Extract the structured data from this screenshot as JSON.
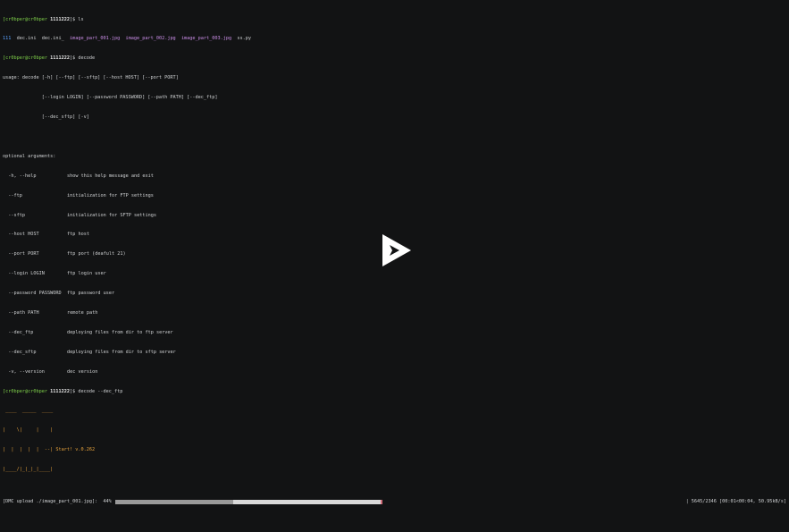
{
  "terminal": {
    "l1_user": "[cr0bper@cr0bper",
    "l1_host": "1111222",
    "l1_rest": "]$ ls",
    "ls_dir": "111",
    "ls_f1": "dec.ini",
    "ls_f2": "dec.ini_",
    "ls_img1": "image_part_001.jpg",
    "ls_img2": "image_part_002.jpg",
    "ls_img3": "image_part_003.jpg",
    "ls_py": "ss.py",
    "l3_user": "[cr0bper@cr0bper",
    "l3_host": "1111222",
    "l3_rest": "]$ decode",
    "usage1": "usage: decode [-h] [--ftp] [--sftp] [--host HOST] [--port PORT]",
    "usage2": "              [--login LOGIN] [--password PASSWORD] [--path PATH] [--dec_ftp]",
    "usage3": "              [--dec_sftp] [-v]",
    "optional_header": "optional arguments:",
    "options": [
      {
        "flag": "  -h, --help",
        "desc": "show this help message and exit"
      },
      {
        "flag": "  --ftp",
        "desc": "initialization for FTP settings"
      },
      {
        "flag": "  --sftp",
        "desc": "initialization for SFTP settings"
      },
      {
        "flag": "  --host HOST",
        "desc": "ftp host"
      },
      {
        "flag": "  --port PORT",
        "desc": "ftp port (deafult 21)"
      },
      {
        "flag": "  --login LOGIN",
        "desc": "ftp login user"
      },
      {
        "flag": "  --password PASSWORD",
        "desc": "ftp password user"
      },
      {
        "flag": "  --path PATH",
        "desc": "remote path"
      },
      {
        "flag": "  --dec_ftp",
        "desc": "deploying files from dir to ftp server"
      },
      {
        "flag": "  --dec_sftp",
        "desc": "deploying files from dir to sftp server"
      },
      {
        "flag": "  -v, --version",
        "desc": "dec version"
      }
    ],
    "l_cmd_user": "[cr0bper@cr0bper",
    "l_cmd_host": "1111222",
    "l_cmd_rest": "]$ decode --dec_ftp",
    "art1": " ____  _____  ____",
    "art2": "|    \\|     |    |",
    "art3": "|  |  |  |  |  --| Start! v.0.262",
    "art4": "|____/|_|_|_|____|",
    "progress_prefix": "[DMC upload ./image_part_001.jpg]:  44%",
    "progress_suffix": "| 5645/2346 [00:01<00:04, 50.95kB/s]",
    "progress_percent": 44
  },
  "player": {
    "play_icon": "play-icon"
  },
  "colors": {
    "background": "#121314",
    "prompt": "#7fd04a",
    "art": "#e6a23c",
    "image_files": "#c98de6"
  }
}
